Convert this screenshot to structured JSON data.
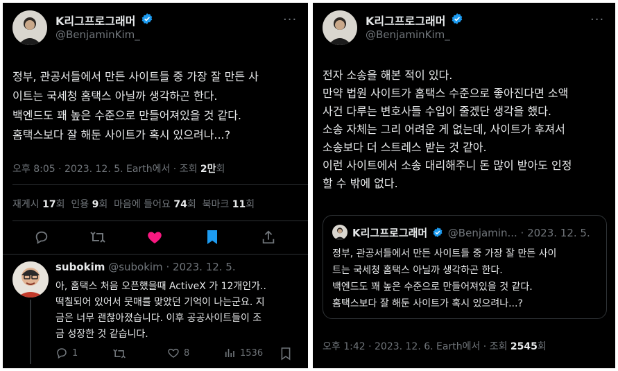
{
  "left": {
    "author": {
      "name": "K리그프로그래머",
      "handle": "@BenjaminKim_"
    },
    "more": "···",
    "tweet_lines": [
      "정부, 관공서들에서 만든 사이트들 중 가장 잘 만든 사",
      "이트는 국세청 홈택스 아닐까 생각하곤 한다.",
      "백엔드도 꽤 높은 수준으로 만들어져있을 것 같다.",
      "홈택스보다 잘 해둔 사이트가 혹시 있으려나...?"
    ],
    "meta": {
      "time": "오후 8:05 · 2023. 12. 5. Earth에서 · 조회 ",
      "views": "2만",
      "suffix": "회"
    },
    "stats": {
      "retweet_label": "재게시 ",
      "retweet_count": "17",
      "retweet_unit": "회",
      "quote_label": "인용 ",
      "quote_count": "9",
      "quote_unit": "회",
      "like_label": "마음에 들어요 ",
      "like_count": "74",
      "like_unit": "회",
      "bookmark_label": "북마크 ",
      "bookmark_count": "11",
      "bookmark_unit": "회"
    },
    "reply": {
      "name": "subokim",
      "handle_date": "@subokim · 2023. 12. 5.",
      "lines": [
        "아, 홈택스 처음 오픈했을때 ActiveX 가 12개인가..",
        "떡칠되어 있어서 뭇매를 맞았던 기억이 나는군요. 지",
        "금은 너무 괜찮아졌습니다. 이후 공공사이트들이 조",
        "금 성장한 것 같습니다."
      ],
      "reply_count": "1",
      "like_count": "8",
      "view_count": "1536"
    },
    "colors": {
      "like": "#f91880",
      "bookmark": "#1d9bf0",
      "verified": "#1d9bf0"
    }
  },
  "right": {
    "author": {
      "name": "K리그프로그래머",
      "handle": "@BenjaminKim_"
    },
    "more": "···",
    "tweet_lines": [
      "전자 소송을 해본 적이 있다.",
      "만약 법원 사이트가 홈택스 수준으로 좋아진다면 소액",
      "사건 다루는 변호사들 수입이 줄겠단 생각을 했다.",
      "소송 자체는 그리 어려운 게 없는데, 사이트가 후져서",
      "소송보다 더 스트레스 받는 것 같아.",
      "이런 사이트에서 소송 대리해주니 돈 많이 받아도 인정",
      "할 수 밖에 없다."
    ],
    "quote": {
      "name": "K리그프로그래머",
      "handle_date": "@Benjamin... · 2023. 12. 5.",
      "lines": [
        "정부, 관공서들에서 만든 사이트들 중 가장 잘 만든 사이",
        "트는 국세청 홈택스 아닐까 생각하곤 한다.",
        "백엔드도 꽤 높은 수준으로 만들어져있을 것 같다.",
        "홈택스보다 잘 해둔 사이트가 혹시 있으려나...?"
      ]
    },
    "meta": {
      "time": "오후 1:42 · 2023. 12. 6. Earth에서 · 조회 ",
      "views": "2545",
      "suffix": "회"
    }
  }
}
